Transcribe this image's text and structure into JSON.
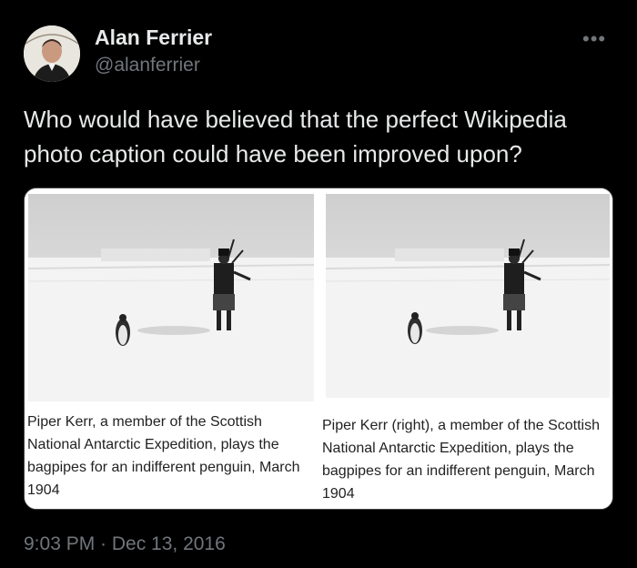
{
  "author": {
    "display_name": "Alan Ferrier",
    "handle": "@alanferrier"
  },
  "more_icon": "•••",
  "tweet_text": "Who would have believed that the perfect Wikipedia photo caption could have been improved upon?",
  "images": [
    {
      "caption": "Piper Kerr, a member of the Scottish National Antarctic Expedition, plays the bagpipes for an indifferent penguin, March 1904"
    },
    {
      "caption": "Piper Kerr (right), a member of the Scottish National Antarctic Expedition, plays the bagpipes for an indifferent penguin, March 1904"
    }
  ],
  "timestamp": "9:03 PM · Dec 13, 2016"
}
